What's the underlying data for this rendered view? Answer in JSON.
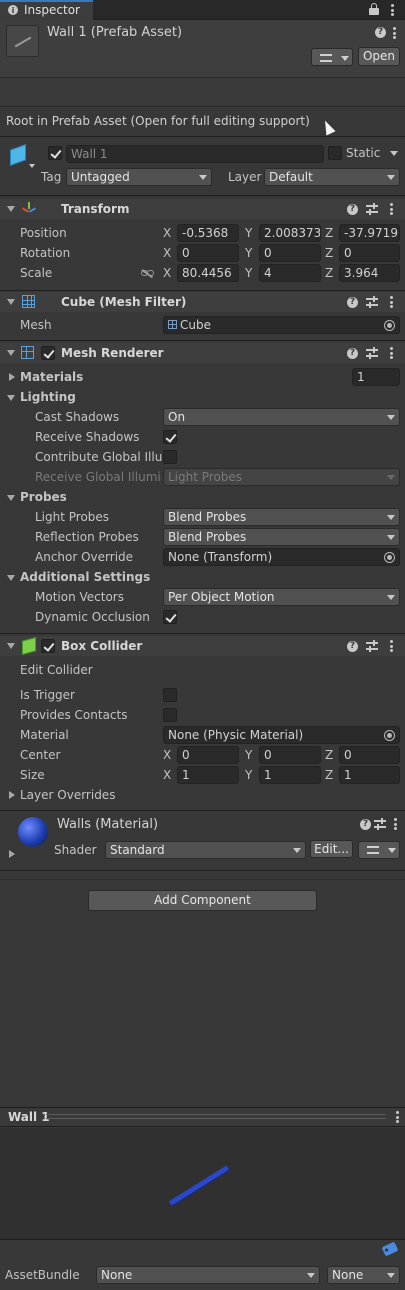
{
  "tab": {
    "label": "Inspector"
  },
  "header": {
    "title": "Wall 1 (Prefab Asset)",
    "open_label": "Open"
  },
  "prefab_note": "Root in Prefab Asset (Open for full editing support)",
  "object": {
    "name": "Wall 1",
    "static_label": "Static",
    "tag_label": "Tag",
    "tag_value": "Untagged",
    "layer_label": "Layer",
    "layer_value": "Default"
  },
  "transform": {
    "title": "Transform",
    "rows": [
      {
        "label": "Position",
        "x": "-0.5368",
        "y": "2.008373",
        "z": "-37.9719"
      },
      {
        "label": "Rotation",
        "x": "0",
        "y": "0",
        "z": "0"
      },
      {
        "label": "Scale",
        "x": "80.4456",
        "y": "4",
        "z": "3.964"
      }
    ]
  },
  "axes": {
    "x": "X",
    "y": "Y",
    "z": "Z"
  },
  "mesh_filter": {
    "title": "Cube (Mesh Filter)",
    "mesh_label": "Mesh",
    "mesh_value": "Cube"
  },
  "mesh_renderer": {
    "title": "Mesh Renderer",
    "materials_label": "Materials",
    "materials_count": "1",
    "lighting_label": "Lighting",
    "cast_shadows_label": "Cast Shadows",
    "cast_shadows_value": "On",
    "receive_shadows_label": "Receive Shadows",
    "contribute_gi_label": "Contribute Global Illum",
    "receive_gi_label": "Receive Global Illumina",
    "receive_gi_value": "Light Probes",
    "probes_label": "Probes",
    "light_probes_label": "Light Probes",
    "light_probes_value": "Blend Probes",
    "reflection_probes_label": "Reflection Probes",
    "reflection_probes_value": "Blend Probes",
    "anchor_override_label": "Anchor Override",
    "anchor_override_value": "None (Transform)",
    "additional_label": "Additional Settings",
    "motion_vectors_label": "Motion Vectors",
    "motion_vectors_value": "Per Object Motion",
    "dynamic_occlusion_label": "Dynamic Occlusion"
  },
  "box_collider": {
    "title": "Box Collider",
    "edit_collider_label": "Edit Collider",
    "is_trigger_label": "Is Trigger",
    "provides_contacts_label": "Provides Contacts",
    "material_label": "Material",
    "material_value": "None (Physic Material)",
    "center_label": "Center",
    "center": {
      "x": "0",
      "y": "0",
      "z": "0"
    },
    "size_label": "Size",
    "size": {
      "x": "1",
      "y": "1",
      "z": "1"
    },
    "layer_overrides_label": "Layer Overrides"
  },
  "material": {
    "title": "Walls (Material)",
    "shader_label": "Shader",
    "shader_value": "Standard",
    "edit_label": "Edit..."
  },
  "add_component_label": "Add Component",
  "preview": {
    "title": "Wall 1"
  },
  "asset_bundle": {
    "label": "AssetBundle",
    "name_value": "None",
    "variant_value": "None"
  },
  "colors": {
    "background": "#383838",
    "field": "#2a2a2a",
    "accent_blue": "#1f3fb0"
  },
  "icons": [
    "lock-icon",
    "dots-menu-icon",
    "help-icon",
    "presets-icon",
    "transform-icon",
    "mesh-filter-icon",
    "mesh-renderer-icon",
    "box-collider-icon",
    "material-sphere-icon",
    "cube-prefab-icon",
    "asset-label-icon",
    "link-icon",
    "object-picker-icon"
  ]
}
